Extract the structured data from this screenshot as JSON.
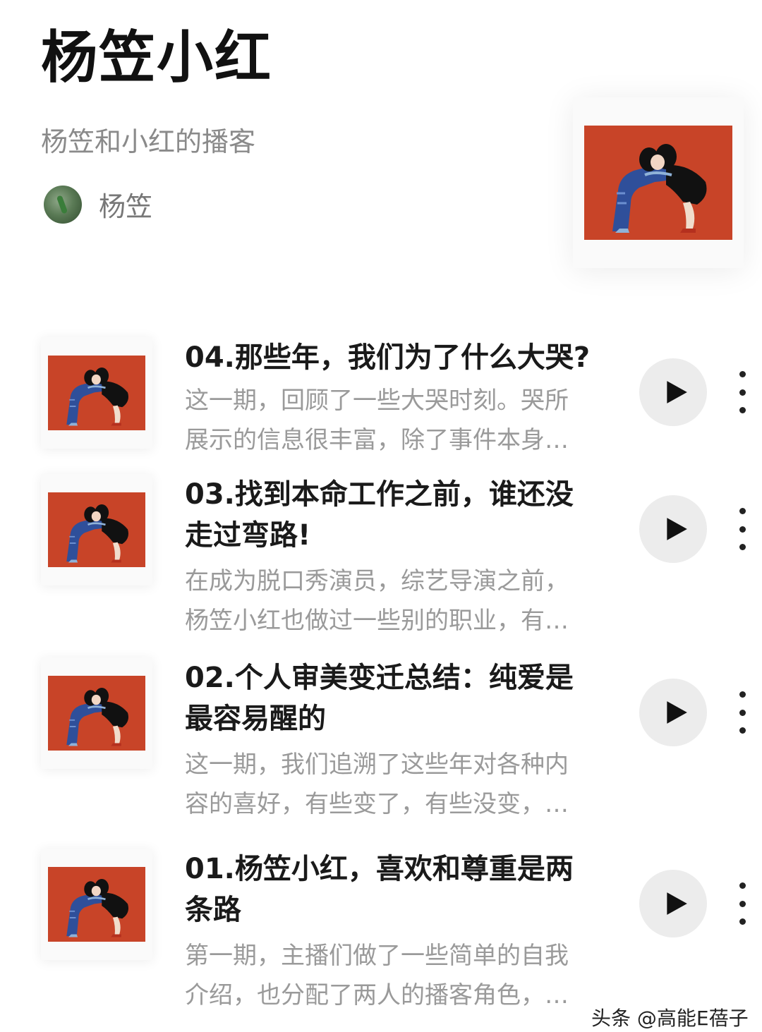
{
  "podcast": {
    "title": "杨笠小红",
    "subtitle": "杨笠和小红的播客",
    "author": "杨笠"
  },
  "episodes": [
    {
      "title": "04.那些年，我们为了什么大哭?",
      "desc_line1": "这一期，回顾了一些大哭时刻。哭所",
      "desc_line2": "展示的信息很丰富，除了事件本身…"
    },
    {
      "title_line1": "03.找到本命工作之前，谁还没",
      "title_line2": "走过弯路!",
      "desc_line1": "在成为脱口秀演员，综艺导演之前，",
      "desc_line2": "杨笠小红也做过一些别的职业，有…"
    },
    {
      "title_line1": "02.个人审美变迁总结：纯爱是",
      "title_line2": "最容易醒的",
      "desc_line1": "这一期，我们追溯了这些年对各种内",
      "desc_line2": "容的喜好，有些变了，有些没变，…"
    },
    {
      "title_line1": "01.杨笠小红，喜欢和尊重是两",
      "title_line2": "条路",
      "desc_line1": "第一期，主播们做了一些简单的自我",
      "desc_line2": "介绍，也分配了两人的播客角色，…"
    }
  ],
  "watermark": "头条 @高能E蓓子",
  "icons": {
    "play": "play-icon",
    "more": "more-vertical-icon",
    "cover": "cover-art-hugging-figures"
  },
  "colors": {
    "cover_background": "#c84428",
    "play_button": "#ececec"
  }
}
